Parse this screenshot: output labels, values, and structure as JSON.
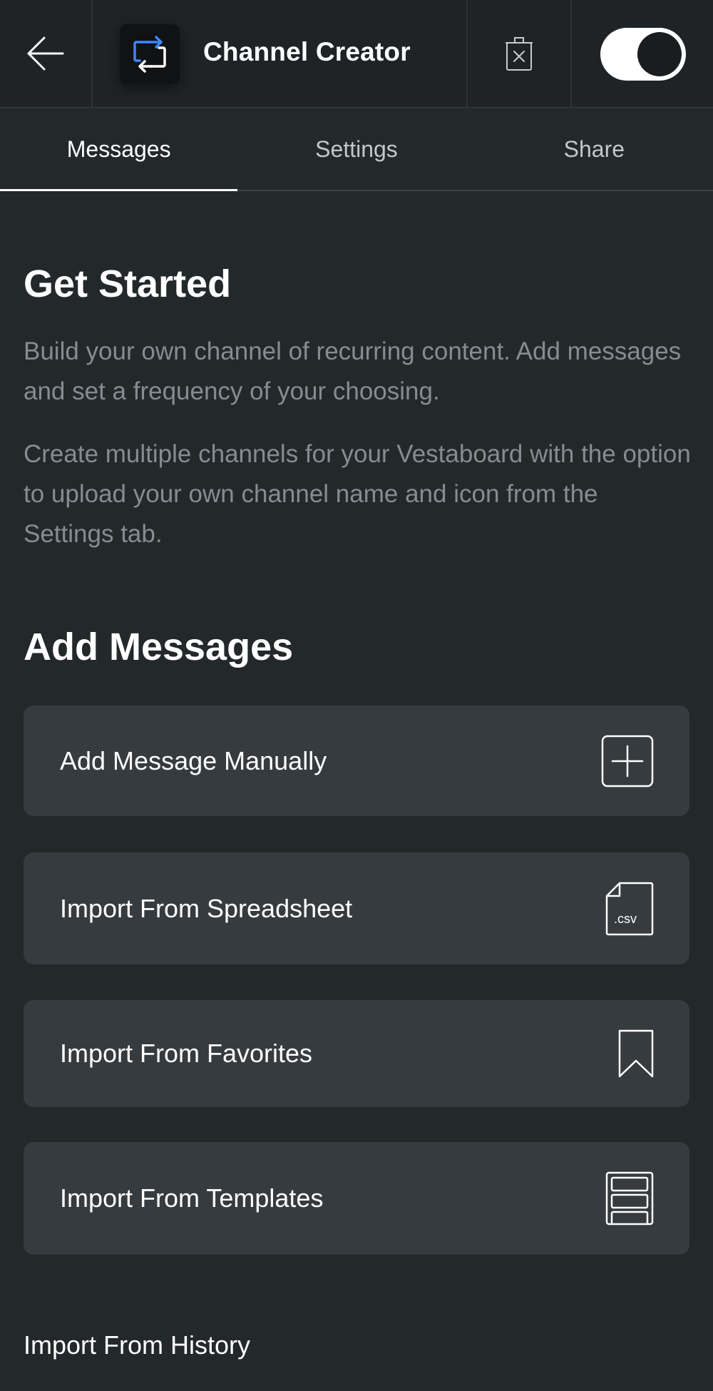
{
  "header": {
    "title": "Channel Creator",
    "back_icon": "back-arrow-icon",
    "channel_icon": "repeat-chat-icon",
    "delete_icon": "trash-icon",
    "toggle_on": true,
    "accent_color": "#3d86ff"
  },
  "tabs": [
    {
      "label": "Messages",
      "active": true
    },
    {
      "label": "Settings",
      "active": false
    },
    {
      "label": "Share",
      "active": false
    }
  ],
  "get_started": {
    "heading": "Get Started",
    "paragraph1": "Build your own channel of recurring content. Add messages and set a frequency of your choosing.",
    "paragraph2": "Create multiple channels for your Vestaboard with the option to upload your own channel name and icon from the Settings tab."
  },
  "add_messages": {
    "heading": "Add Messages",
    "actions": [
      {
        "label": "Add Message Manually",
        "icon": "plus-square-icon"
      },
      {
        "label": "Import From Spreadsheet",
        "icon": "csv-file-icon",
        "icon_text": ".csv"
      },
      {
        "label": "Import From Favorites",
        "icon": "bookmark-icon"
      },
      {
        "label": "Import From Templates",
        "icon": "templates-icon"
      }
    ],
    "history_link": "Import From History"
  }
}
